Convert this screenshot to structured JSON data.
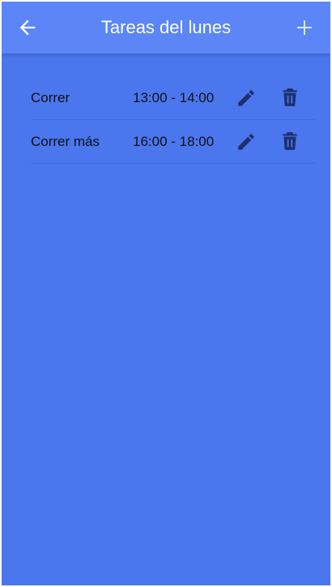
{
  "header": {
    "title": "Tareas del lunes",
    "back_icon": "arrow-left-icon",
    "add_icon": "plus-icon"
  },
  "tasks": [
    {
      "name": "Correr",
      "time": "13:00 - 14:00"
    },
    {
      "name": "Correr más",
      "time": "16:00 - 18:00"
    }
  ],
  "icons": {
    "edit": "pencil-icon",
    "delete": "trash-icon"
  },
  "colors": {
    "background": "#4a76ee",
    "header": "#5c86f7",
    "icon_dark": "#1e2f6e",
    "text": "#111111"
  }
}
